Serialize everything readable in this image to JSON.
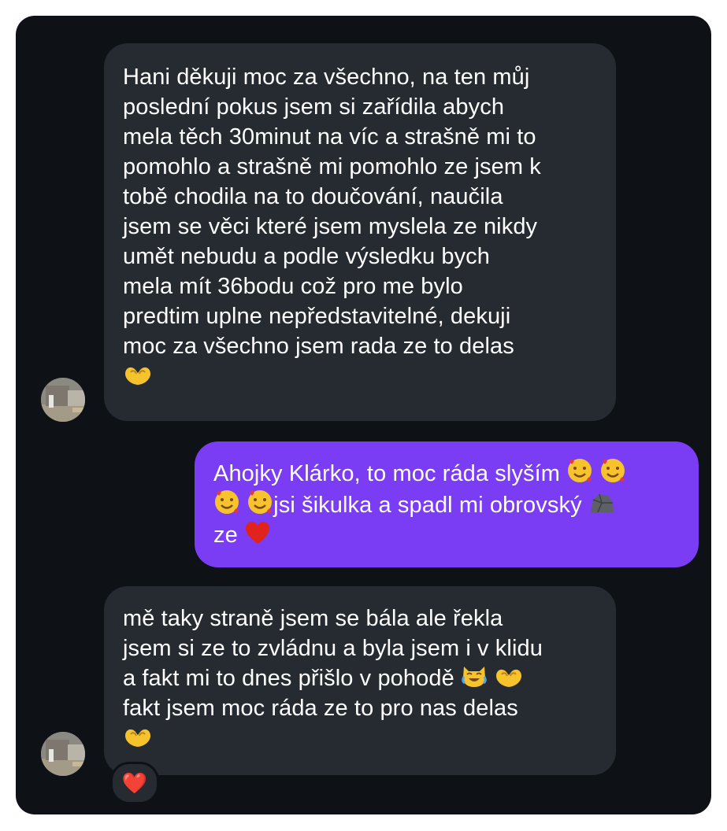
{
  "conversation": {
    "messages": [
      {
        "direction": "incoming",
        "lines": [
          "Hani děkuji moc za všechno, na ten můj",
          "poslední pokus jsem si zařídila abych",
          "mela těch 30minut na víc a strašně mi to",
          "pomohlo a strašně mi pomohlo ze jsem k",
          "tobě chodila na to doučování, naučila",
          "jsem se věci které jsem myslela ze nikdy",
          "umět nebudu a podle výsledku bych",
          "mela mít 36bodu což pro me bylo",
          "predtim uplne nepředstavitelné, dekuji",
          "moc za všechno jsem rada ze to delas"
        ],
        "trailing_emoji": "heart-hands"
      },
      {
        "direction": "outgoing",
        "line1": "Ahojky Klárko, to moc ráda slyším",
        "line2": "jsi šikulka a spadl mi obrovský",
        "line3": "ze",
        "emoji": [
          "smiling-face-with-hearts",
          "smiling-face-with-hearts",
          "smiling-face-with-hearts",
          "smiling-face-with-hearts",
          "rock",
          "red-heart"
        ]
      },
      {
        "direction": "incoming",
        "lines": [
          "mě taky straně jsem se bála ale řekla",
          "jsem si ze to zvládnu a byla jsem i v klidu",
          "a fakt mi to dnes přišlo v pohodě",
          "fakt jsem moc ráda ze to pro nas delas"
        ],
        "inline_emoji": [
          "cat-tears-of-joy",
          "heart-hands"
        ],
        "trailing_emoji": "heart-hands",
        "reaction": "❤️"
      }
    ]
  },
  "colors": {
    "panel": "#0e1116",
    "incoming_bubble": "#262a31",
    "outgoing_bubble": "#7b3df3",
    "text": "#ffffff"
  }
}
